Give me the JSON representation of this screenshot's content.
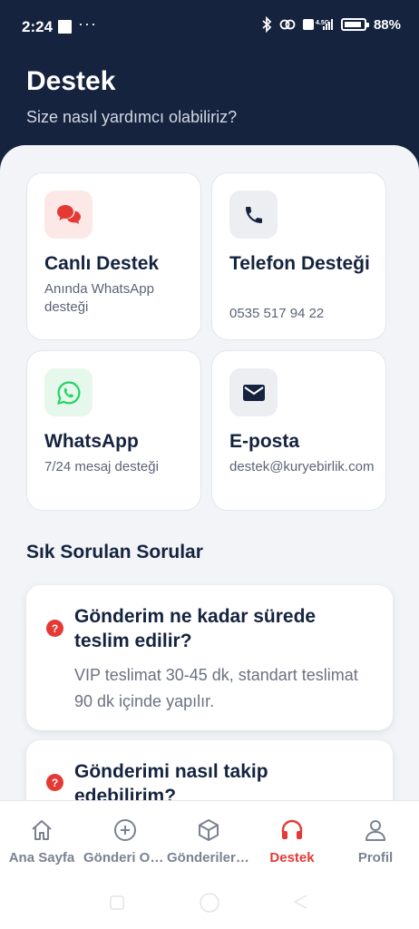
{
  "status_bar": {
    "time": "2:24",
    "more": "···",
    "network": "4.5G",
    "battery": "88%"
  },
  "header": {
    "title": "Destek",
    "subtitle": "Size nasıl yardımcı olabiliriz?"
  },
  "contact_cards": [
    {
      "title": "Canlı Destek",
      "subtitle": "Anında WhatsApp desteği",
      "icon": "chat-bubbles-icon",
      "icon_color": "#e53935",
      "icon_bg": "#fde8e8"
    },
    {
      "title": "Telefon Desteği",
      "subtitle": "0535 517 94 22",
      "icon": "phone-icon",
      "icon_color": "#15233f",
      "icon_bg": "#eceef2"
    },
    {
      "title": "WhatsApp",
      "subtitle": "7/24 mesaj desteği",
      "icon": "whatsapp-icon",
      "icon_color": "#25d366",
      "icon_bg": "#e6f7ec"
    },
    {
      "title": "E-posta",
      "subtitle": "destek@kuryebirlik.com",
      "icon": "mail-icon",
      "icon_color": "#15233f",
      "icon_bg": "#eceef2"
    }
  ],
  "faq": {
    "title": "Sık Sorulan Sorular",
    "items": [
      {
        "question": "Gönderim ne kadar sürede teslim edilir?",
        "answer": "VIP teslimat 30-45 dk, standart teslimat 90 dk içinde yapılır."
      },
      {
        "question": "Gönderimi nasıl takip edebilirim?",
        "answer": ""
      }
    ]
  },
  "tabs": [
    {
      "label": "Ana Sayfa",
      "icon": "home-icon",
      "active": false
    },
    {
      "label": "Gönderi Oluştur",
      "icon": "plus-circle-icon",
      "active": false
    },
    {
      "label": "Gönderilerim",
      "icon": "box-icon",
      "active": false
    },
    {
      "label": "Destek",
      "icon": "headphones-icon",
      "active": true
    },
    {
      "label": "Profil",
      "icon": "user-icon",
      "active": false
    }
  ],
  "colors": {
    "header_bg": "#15233f",
    "accent": "#e53935",
    "page_bg": "#f2f4f8"
  }
}
